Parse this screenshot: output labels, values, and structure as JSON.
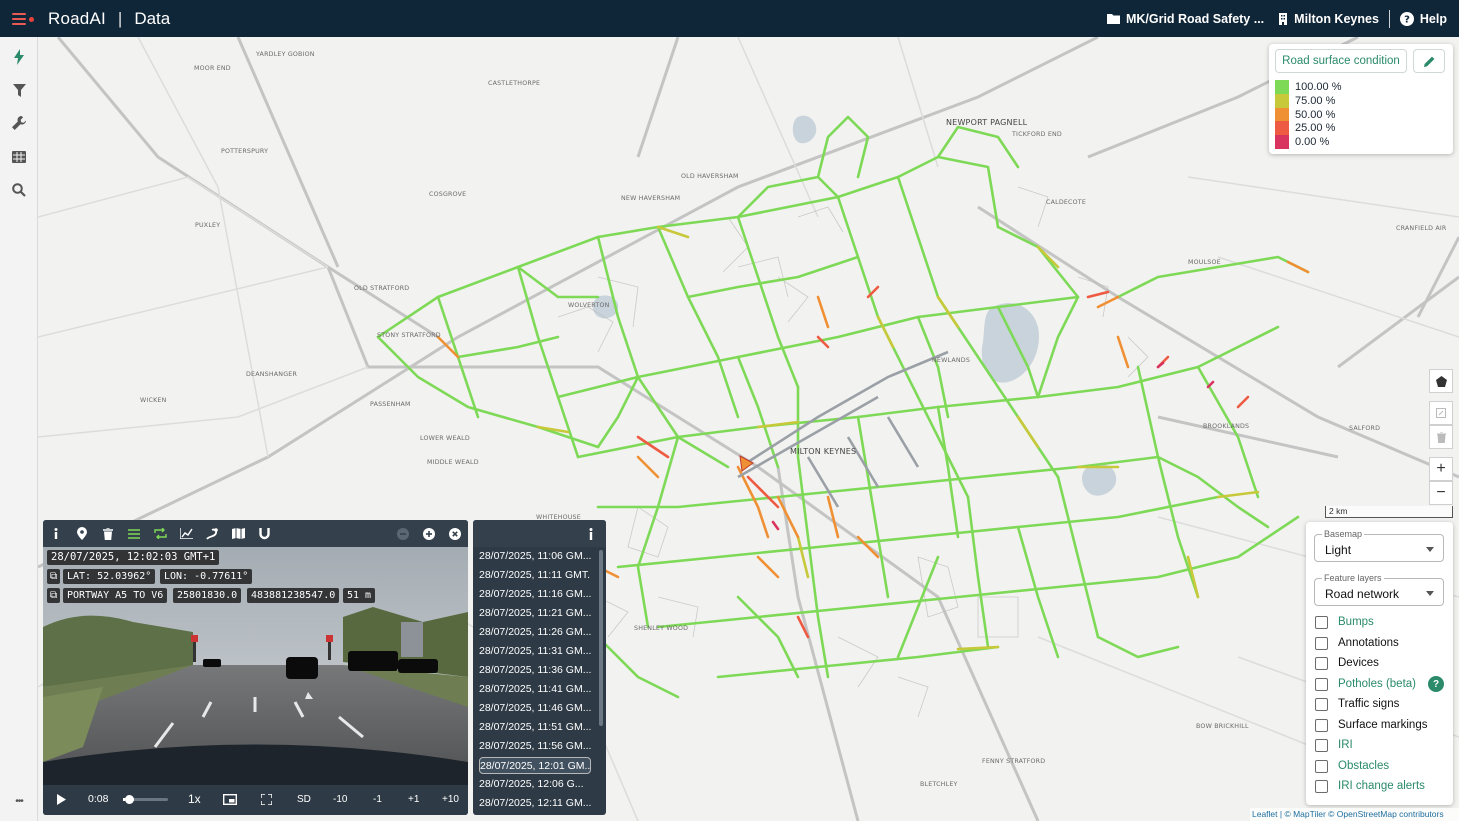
{
  "app": {
    "brand": "RoadAI",
    "separator": "|",
    "section": "Data"
  },
  "topbar": {
    "project": "MK/Grid Road Safety ...",
    "city": "Milton Keynes",
    "help": "Help"
  },
  "sidebar": {
    "items": [
      "lightning-icon",
      "filter-icon",
      "wrench-icon",
      "table-icon",
      "search-icon"
    ],
    "more": "•••"
  },
  "legend": {
    "title": "Road surface condition",
    "items": [
      {
        "label": "100.00 %",
        "color": "#7ed957"
      },
      {
        "label": "75.00 %",
        "color": "#c7c93a"
      },
      {
        "label": "50.00 %",
        "color": "#f09035"
      },
      {
        "label": "25.00 %",
        "color": "#ee5a42"
      },
      {
        "label": "0.00 %",
        "color": "#d8345f"
      }
    ]
  },
  "map": {
    "scale_label": "2 km",
    "attribution": "Leaflet | © MapTiler © OpenStreetMap contributors",
    "places": [
      {
        "name": "YARDLEY GOBION"
      },
      {
        "name": "MOOR END"
      },
      {
        "name": "CASTLETHORPE"
      },
      {
        "name": "POTTERSPURY"
      },
      {
        "name": "COSGROVE"
      },
      {
        "name": "PUXLEY"
      },
      {
        "name": "OLD HAVERSHAM"
      },
      {
        "name": "NEW HAVERSHAM"
      },
      {
        "name": "NEWPORT PAGNELL"
      },
      {
        "name": "TICKFORD END"
      },
      {
        "name": "CALDECOTE"
      },
      {
        "name": "CRANFIELD AIR"
      },
      {
        "name": "OLD STRATFORD"
      },
      {
        "name": "STONY STRATFORD"
      },
      {
        "name": "WOLVERTON"
      },
      {
        "name": "MOULSOE"
      },
      {
        "name": "DEANSHANGER"
      },
      {
        "name": "PASSENHAM"
      },
      {
        "name": "WICKEN"
      },
      {
        "name": "LOWER WEALD"
      },
      {
        "name": "MIDDLE WEALD"
      },
      {
        "name": "MILTON KEYNES"
      },
      {
        "name": "SALFORD"
      },
      {
        "name": "WHITEHOUSE"
      },
      {
        "name": "FENNY STRATFORD"
      },
      {
        "name": "BLETCHLEY"
      },
      {
        "name": "BOW BRICKHILL"
      },
      {
        "name": "SHENLEY WOOD"
      },
      {
        "name": "NEWLANDS"
      },
      {
        "name": "BROOKLANDS"
      }
    ]
  },
  "layers": {
    "basemap_label": "Basemap",
    "basemap_value": "Light",
    "features_label": "Feature layers",
    "features_value": "Road network",
    "checkboxes": [
      {
        "label": "Bumps",
        "color": "#2a8a6a"
      },
      {
        "label": "Annotations",
        "color": "#111111"
      },
      {
        "label": "Devices",
        "color": "#111111"
      },
      {
        "label": "Potholes (beta)",
        "color": "#2a8a6a"
      },
      {
        "label": "Traffic signs",
        "color": "#111111"
      },
      {
        "label": "Surface markings",
        "color": "#111111"
      },
      {
        "label": "IRI",
        "color": "#2a8a6a"
      },
      {
        "label": "Obstacles",
        "color": "#2a8a6a"
      },
      {
        "label": "IRI change alerts",
        "color": "#2a8a6a"
      }
    ],
    "help_badge": "?"
  },
  "player": {
    "timestamp": "28/07/2025, 12:02:03 GMT+1",
    "lat": "LAT: 52.03962°",
    "lon": "LON: -0.77611°",
    "road": "PORTWAY A5 TO V6",
    "id1": "25801830.0",
    "id2": "483881238547.0",
    "dist": "51 m",
    "time": "0:08",
    "progress": 0.04,
    "speed": "1x",
    "quality": "SD",
    "skips": [
      "-10",
      "-1",
      "+1",
      "+10"
    ]
  },
  "timeline": {
    "entries": [
      "28/07/2025, 11:06 GM...",
      "28/07/2025, 11:11 GMT...",
      "28/07/2025, 11:16 GM...",
      "28/07/2025, 11:21 GM...",
      "28/07/2025, 11:26 GM...",
      "28/07/2025, 11:31 GM...",
      "28/07/2025, 11:36 GM...",
      "28/07/2025, 11:41 GM...",
      "28/07/2025, 11:46 GM...",
      "28/07/2025, 11:51 GM...",
      "28/07/2025, 11:56 GM...",
      "28/07/2025, 12:01 GM...",
      "28/07/2025, 12:06 G...",
      "28/07/2025, 12:11 GM..."
    ],
    "selected_index": 11
  }
}
